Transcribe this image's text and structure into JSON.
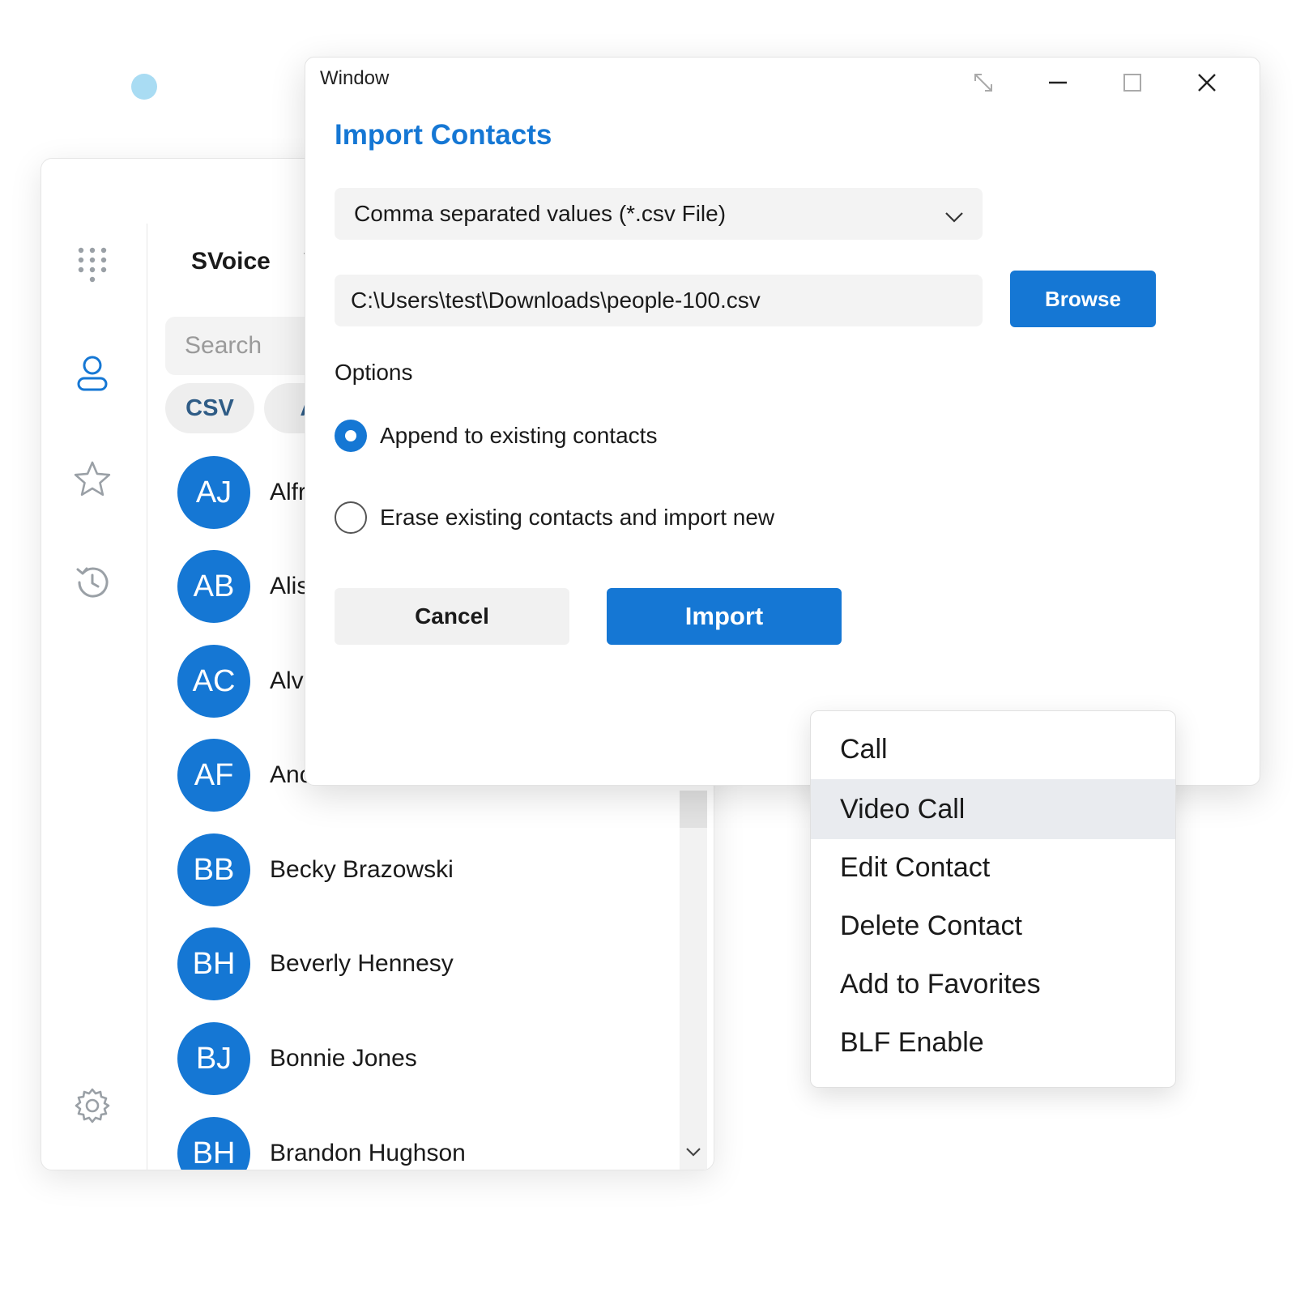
{
  "app": {
    "title": "SVoice",
    "search_placeholder": "Search",
    "chips": [
      {
        "label": "CSV"
      },
      {
        "label": "A"
      }
    ],
    "contacts": [
      {
        "initials": "AJ",
        "name": "Alfr"
      },
      {
        "initials": "AB",
        "name": "Alis"
      },
      {
        "initials": "AC",
        "name": "Alvi"
      },
      {
        "initials": "AF",
        "name": "Anc"
      },
      {
        "initials": "BB",
        "name": "Becky Brazowski"
      },
      {
        "initials": "BH",
        "name": "Beverly Hennesy"
      },
      {
        "initials": "BJ",
        "name": "Bonnie Jones"
      },
      {
        "initials": "BH",
        "name": "Brandon Hughson"
      }
    ],
    "rail_icons": [
      "dialpad-icon",
      "contacts-icon",
      "star-icon",
      "history-icon",
      "settings-icon"
    ],
    "accent_color": "#1577d4"
  },
  "dialog": {
    "window_title": "Window",
    "heading": "Import Contacts",
    "file_type": "Comma separated values (*.csv File)",
    "file_path": "C:\\Users\\test\\Downloads\\people-100.csv",
    "browse_label": "Browse",
    "options_label": "Options",
    "options": [
      {
        "label": "Append to existing contacts",
        "checked": true
      },
      {
        "label": "Erase existing contacts and import new",
        "checked": false
      }
    ],
    "cancel_label": "Cancel",
    "import_label": "Import"
  },
  "context_menu": {
    "items": [
      {
        "label": "Call"
      },
      {
        "label": "Video Call",
        "highlighted": true
      },
      {
        "label": "Edit Contact"
      },
      {
        "label": "Delete Contact"
      },
      {
        "label": "Add to Favorites"
      },
      {
        "label": "BLF Enable"
      }
    ]
  }
}
